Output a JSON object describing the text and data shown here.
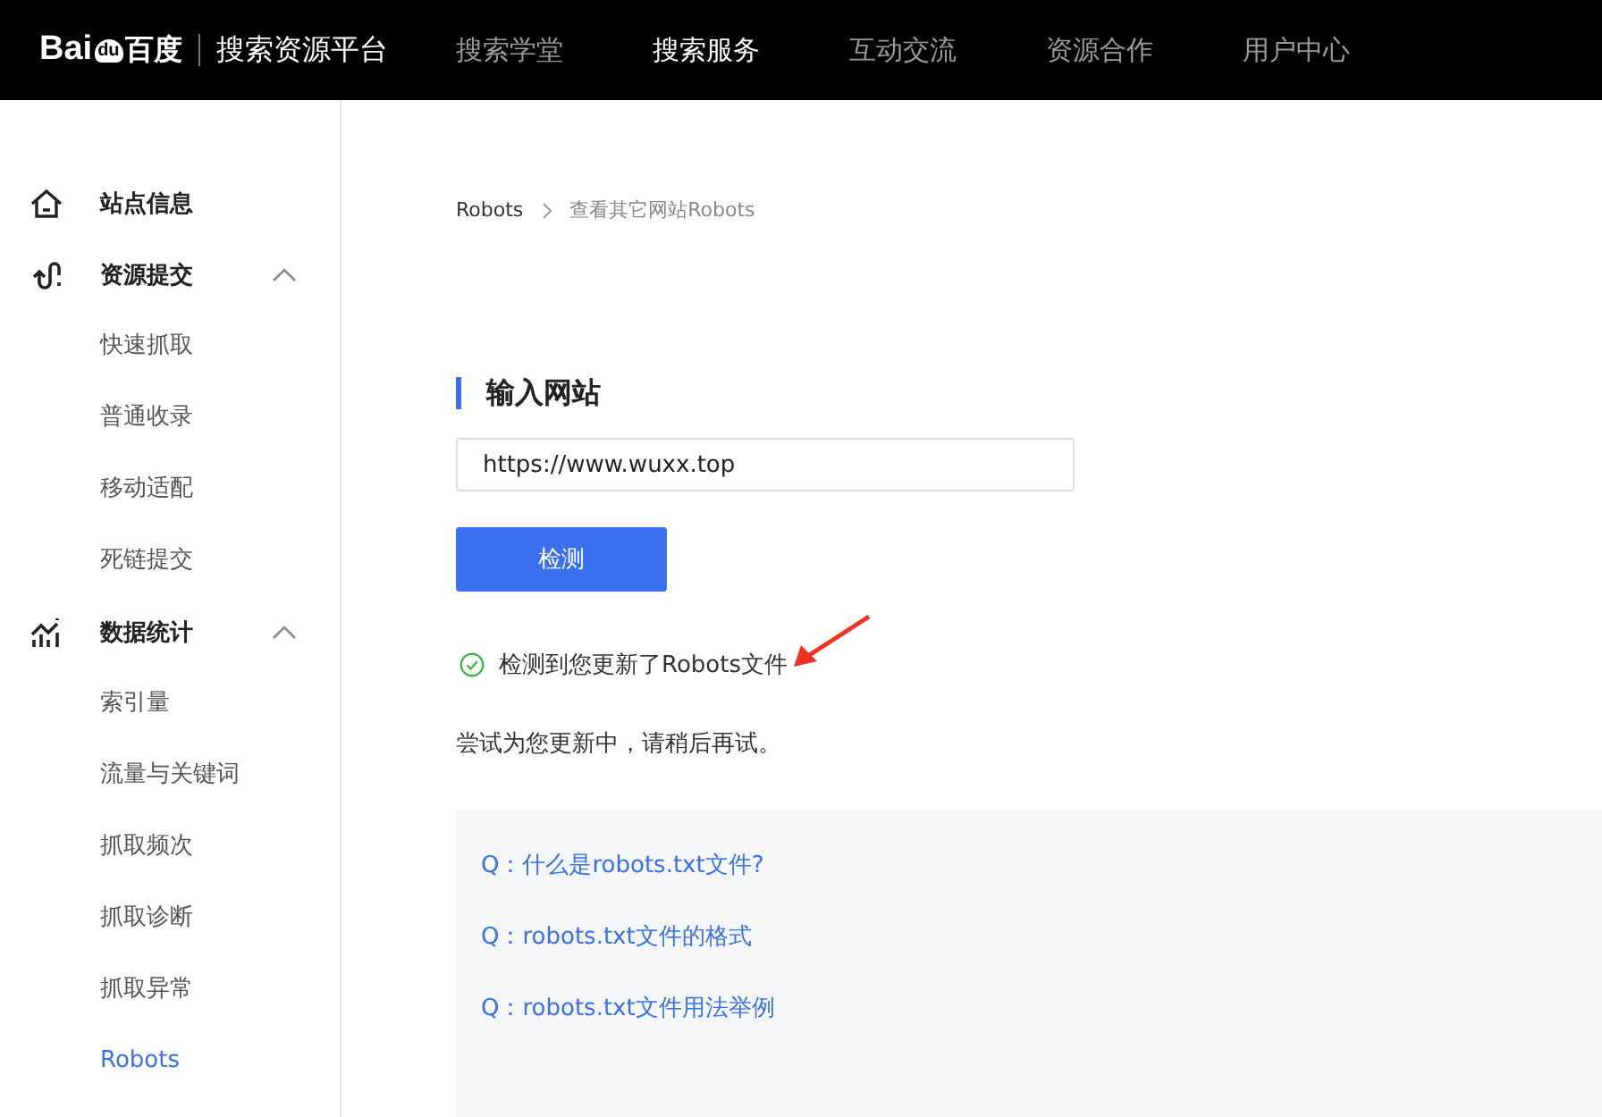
{
  "header": {
    "logo_latin": "Bai",
    "logo_paw": "du",
    "logo_cn": "百度",
    "platform": "搜索资源平台",
    "nav": [
      {
        "label": "搜索学堂",
        "selected": false
      },
      {
        "label": "搜索服务",
        "selected": true
      },
      {
        "label": "互动交流",
        "selected": false
      },
      {
        "label": "资源合作",
        "selected": false
      },
      {
        "label": "用户中心",
        "selected": false
      }
    ]
  },
  "sidebar": {
    "items": [
      {
        "label": "站点信息"
      },
      {
        "label": "资源提交",
        "expanded": true,
        "children": [
          {
            "label": "快速抓取",
            "selected": false
          },
          {
            "label": "普通收录",
            "selected": false
          },
          {
            "label": "移动适配",
            "selected": false
          },
          {
            "label": "死链提交",
            "selected": false
          }
        ]
      },
      {
        "label": "数据统计",
        "expanded": true,
        "children": [
          {
            "label": "索引量",
            "selected": false
          },
          {
            "label": "流量与关键词",
            "selected": false
          },
          {
            "label": "抓取频次",
            "selected": false
          },
          {
            "label": "抓取诊断",
            "selected": false
          },
          {
            "label": "抓取异常",
            "selected": false
          },
          {
            "label": "Robots",
            "selected": true
          }
        ]
      }
    ]
  },
  "breadcrumb": [
    "Robots",
    "查看其它网站Robots"
  ],
  "section_title": "输入网站",
  "url_field": {
    "value": "https://www.wuxx.top"
  },
  "check_button": "检测",
  "result": {
    "message": "检测到您更新了Robots文件"
  },
  "note": "尝试为您更新中，请稍后再试。",
  "faq": [
    "Q：什么是robots.txt文件?",
    "Q：robots.txt文件的格式",
    "Q：robots.txt文件用法举例"
  ]
}
